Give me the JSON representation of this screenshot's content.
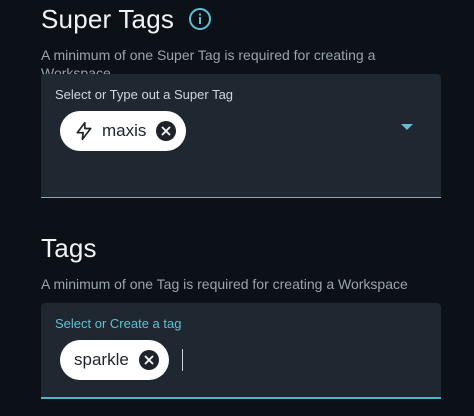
{
  "super_tags": {
    "heading": "Super Tags",
    "helper": "A minimum of one Super Tag is required for creating a Workspace",
    "field_label": "Select or Type out a Super Tag",
    "chips": [
      {
        "label": "maxis",
        "icon": "bolt-icon"
      }
    ]
  },
  "tags": {
    "heading": "Tags",
    "helper": "A minimum of one Tag is required for creating a Workspace",
    "field_label": "Select or Create a tag",
    "chips": [
      {
        "label": "sparkle"
      }
    ]
  },
  "colors": {
    "background": "#0b1117",
    "field": "#1f2830",
    "accent": "#4fb6c9",
    "chip": "#ffffff"
  }
}
